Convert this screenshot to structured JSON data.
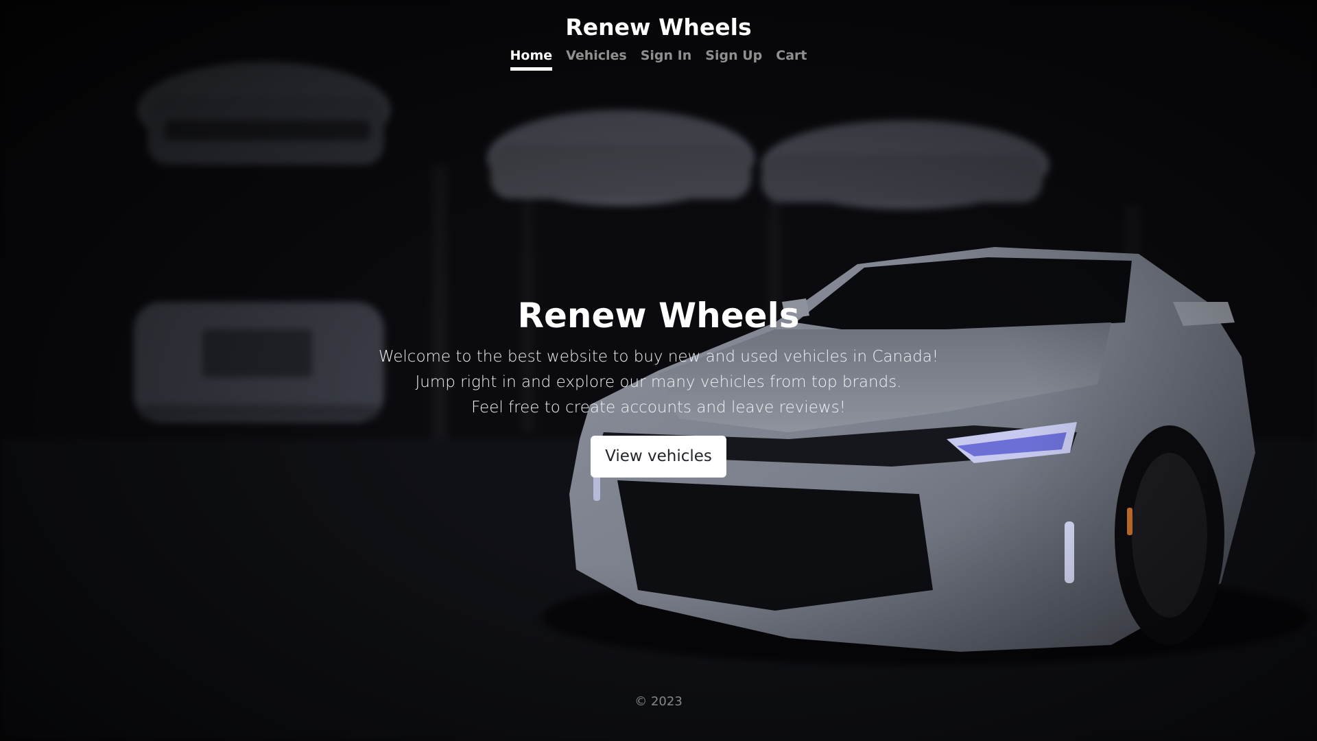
{
  "site": {
    "brand": "Renew Wheels"
  },
  "nav": {
    "items": [
      {
        "label": "Home",
        "active": true
      },
      {
        "label": "Vehicles",
        "active": false
      },
      {
        "label": "Sign In",
        "active": false
      },
      {
        "label": "Sign Up",
        "active": false
      },
      {
        "label": "Cart",
        "active": false
      }
    ]
  },
  "hero": {
    "title": "Renew Wheels",
    "lines": [
      "Welcome to the best website to buy new and used vehicles in Canada!",
      "Jump right in and explore our many vehicles from top brands.",
      "Feel free to create accounts and leave reviews!"
    ],
    "cta_label": "View vehicles"
  },
  "footer": {
    "text": "© 2023"
  },
  "colors": {
    "background": "#08080b",
    "text": "#ffffff",
    "nav_inactive": "rgba(255,255,255,0.55)",
    "button_bg": "#ffffff",
    "button_text": "#212529"
  },
  "background_image": {
    "subject": "dark garage with parked white cars, a white sports car in the foreground on the right"
  }
}
